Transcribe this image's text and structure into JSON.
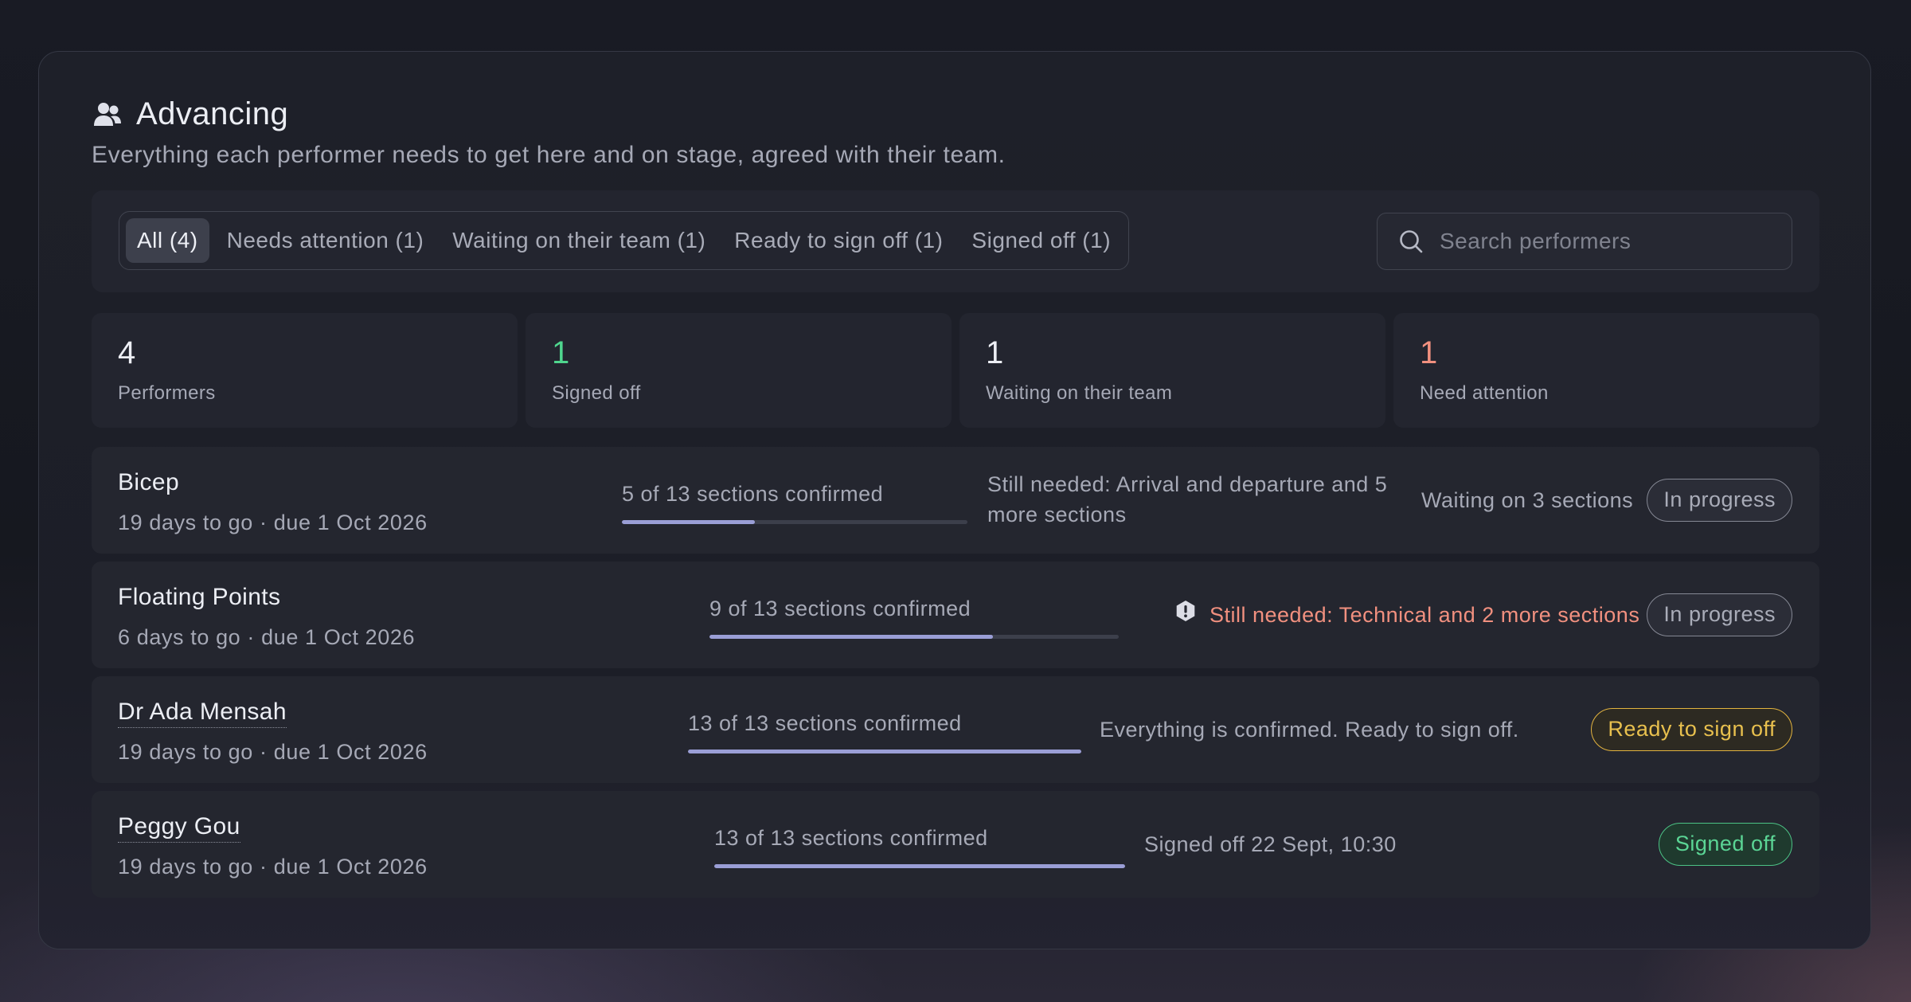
{
  "header": {
    "icon": "users-icon",
    "title": "Advancing",
    "subtitle": "Everything each performer needs to get here and on stage, agreed with their team."
  },
  "tabs": [
    {
      "label": "All (4)",
      "active": true
    },
    {
      "label": "Needs attention (1)",
      "active": false
    },
    {
      "label": "Waiting on their team (1)",
      "active": false
    },
    {
      "label": "Ready to sign off (1)",
      "active": false
    },
    {
      "label": "Signed off (1)",
      "active": false
    }
  ],
  "search": {
    "icon": "search-icon",
    "placeholder": "Search performers",
    "value": ""
  },
  "stats": [
    {
      "value": "4",
      "label": "Performers",
      "color": "#eceef4"
    },
    {
      "value": "1",
      "label": "Signed off",
      "color": "#4fd68e"
    },
    {
      "value": "1",
      "label": "Waiting on their team",
      "color": "#eceef4"
    },
    {
      "value": "1",
      "label": "Need attention",
      "color": "#f1907f"
    }
  ],
  "performers": [
    {
      "name": "Bicep",
      "due": "19 days to go · due 1 Oct 2026",
      "progress_label": "5 of 13 sections confirmed",
      "progress": 0.385,
      "note": "Still needed: Arrival and departure and 5 more sections",
      "waiting": "Waiting on 3 sections",
      "status": "In progress"
    },
    {
      "name": "Floating Points",
      "due": "6 days to go · due 1 Oct 2026",
      "progress_label": "9 of 13 sections confirmed",
      "progress": 0.692,
      "note": "Still needed: Technical and 2 more sections",
      "note_icon": "alert-hexagon-icon",
      "status": "In progress"
    },
    {
      "name": "Dr Ada Mensah",
      "due": "19 days to go · due 1 Oct 2026",
      "progress_label": "13 of 13 sections confirmed",
      "progress": 1.0,
      "note": "Everything is confirmed. Ready to sign off.",
      "status": "Ready to sign off"
    },
    {
      "name": "Peggy Gou",
      "due": "19 days to go · due 1 Oct 2026",
      "progress_label": "13 of 13 sections confirmed",
      "progress": 1.0,
      "note": "Signed off 22 Sept, 10:30",
      "status": "Signed off"
    }
  ],
  "colors": {
    "accent": "#9a9ed6",
    "success": "#4fd68e",
    "warning": "#e8c04e",
    "danger": "#f1907f"
  }
}
